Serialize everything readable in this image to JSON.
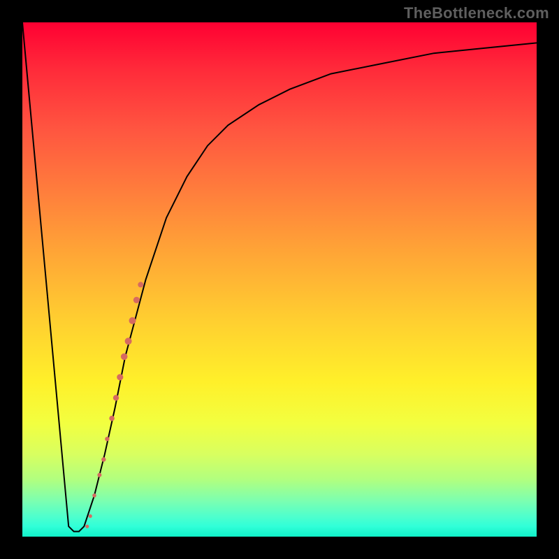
{
  "watermark": {
    "text": "TheBottleneck.com"
  },
  "chart_data": {
    "type": "line",
    "title": "",
    "xlabel": "",
    "ylabel": "",
    "xlim": [
      0,
      100
    ],
    "ylim": [
      0,
      100
    ],
    "series": [
      {
        "name": "bottleneck-curve",
        "x": [
          0,
          9,
          10,
          11,
          12,
          14,
          16,
          18,
          20,
          24,
          28,
          32,
          36,
          40,
          46,
          52,
          60,
          70,
          80,
          90,
          100
        ],
        "y": [
          100,
          2,
          1,
          1,
          2,
          8,
          16,
          25,
          35,
          50,
          62,
          70,
          76,
          80,
          84,
          87,
          90,
          92,
          94,
          95,
          96
        ]
      }
    ],
    "markers": [
      {
        "name": "marker-1",
        "x": 15.0,
        "y": 12,
        "r": 3.0
      },
      {
        "name": "marker-2",
        "x": 15.8,
        "y": 15,
        "r": 3.2
      },
      {
        "name": "marker-3",
        "x": 16.5,
        "y": 19,
        "r": 3.2
      },
      {
        "name": "marker-4",
        "x": 17.4,
        "y": 23,
        "r": 3.8
      },
      {
        "name": "marker-5",
        "x": 18.2,
        "y": 27,
        "r": 4.2
      },
      {
        "name": "marker-6",
        "x": 19.0,
        "y": 31,
        "r": 4.6
      },
      {
        "name": "marker-7",
        "x": 19.8,
        "y": 35,
        "r": 4.8
      },
      {
        "name": "marker-8",
        "x": 20.6,
        "y": 38,
        "r": 5.0
      },
      {
        "name": "marker-9",
        "x": 21.4,
        "y": 42,
        "r": 5.0
      },
      {
        "name": "marker-10",
        "x": 22.2,
        "y": 46,
        "r": 4.6
      },
      {
        "name": "marker-11",
        "x": 23.0,
        "y": 49,
        "r": 4.0
      },
      {
        "name": "marker-12",
        "x": 14.0,
        "y": 8,
        "r": 2.8
      },
      {
        "name": "marker-13",
        "x": 13.2,
        "y": 4,
        "r": 2.6
      },
      {
        "name": "marker-14",
        "x": 12.6,
        "y": 2,
        "r": 2.6
      }
    ],
    "marker_color": "#d66a60",
    "curve_color": "#000000"
  }
}
